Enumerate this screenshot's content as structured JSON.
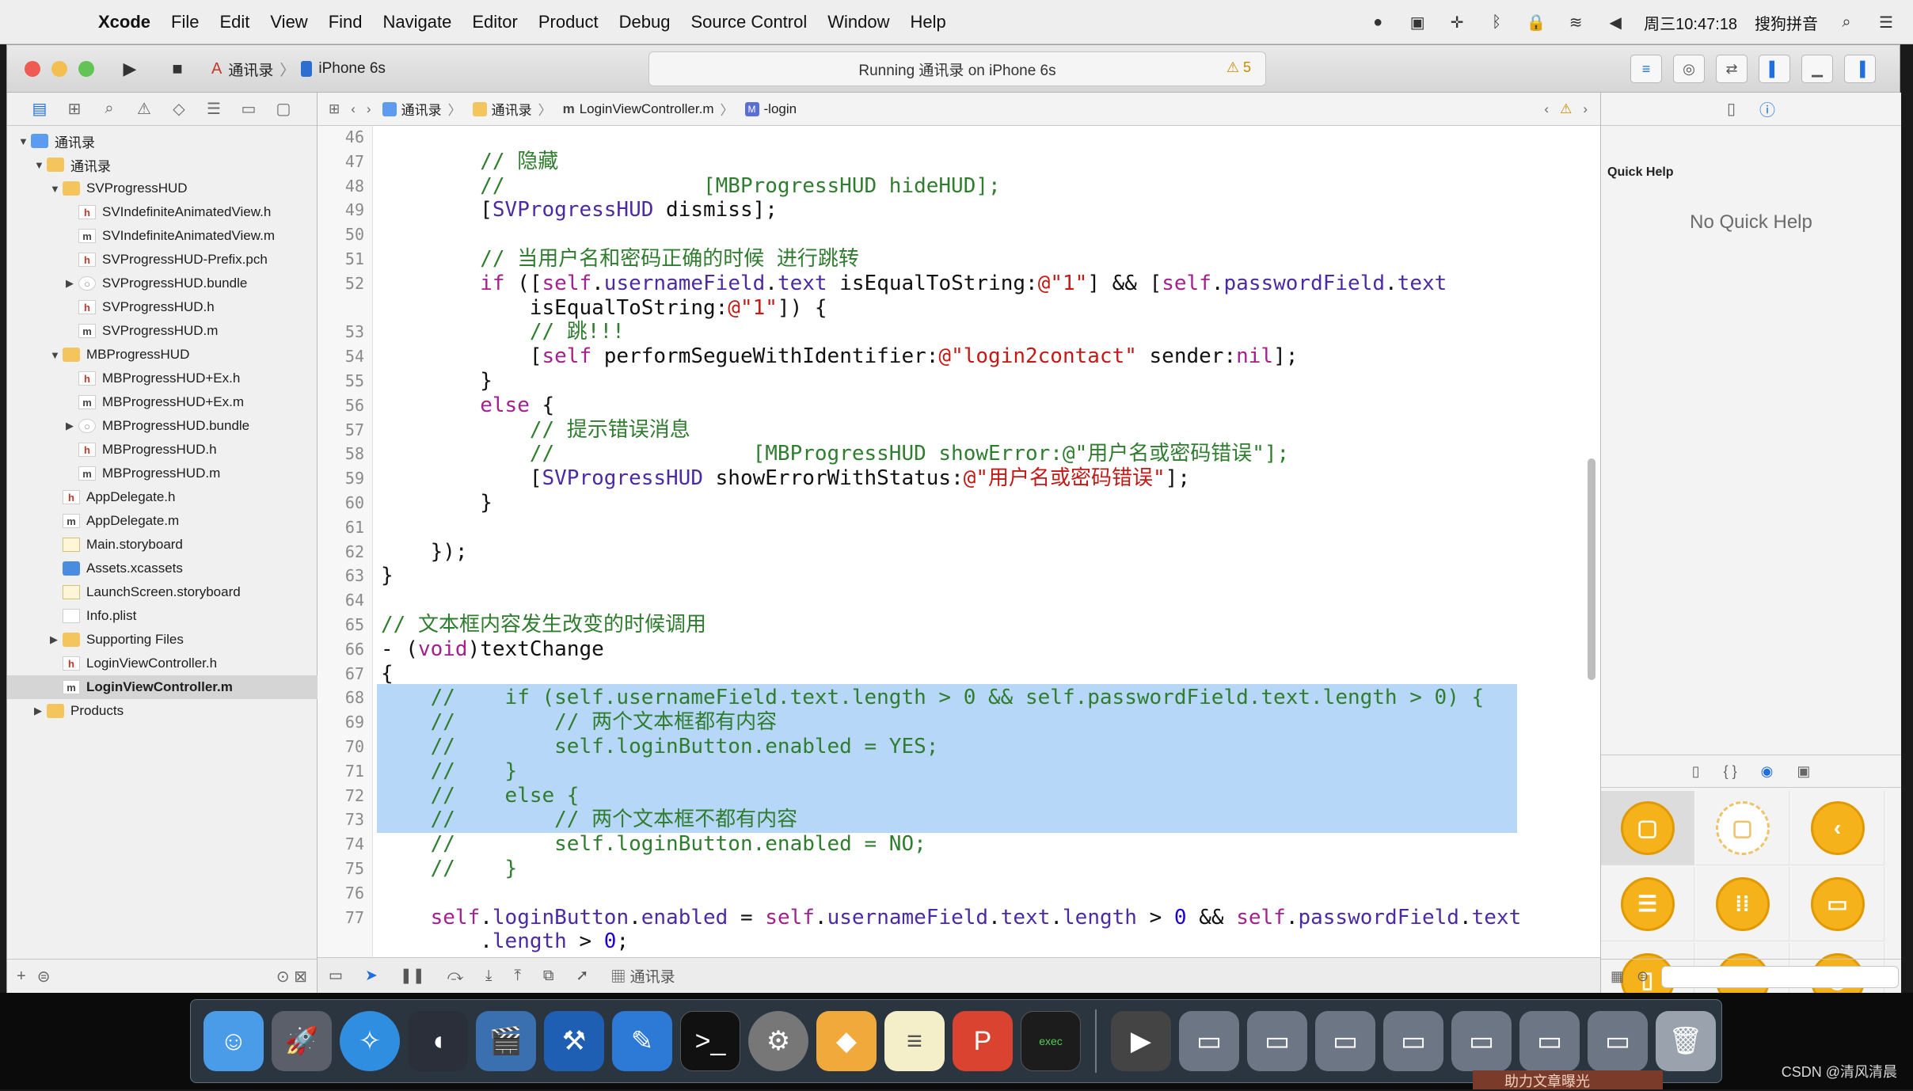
{
  "menubar": {
    "app": "Xcode",
    "items": [
      "File",
      "Edit",
      "View",
      "Find",
      "Navigate",
      "Editor",
      "Product",
      "Debug",
      "Source Control",
      "Window",
      "Help"
    ],
    "clock": "周三10:47:18",
    "input_method": "搜狗拼音"
  },
  "toolbar": {
    "scheme": "通讯录",
    "device": "iPhone 6s",
    "activity": "Running 通讯录 on iPhone 6s",
    "warnings": "5"
  },
  "navigator": {
    "items": [
      {
        "label": "通讯录",
        "icon": "proj",
        "indent": 0,
        "disc": "▼"
      },
      {
        "label": "通讯录",
        "icon": "folder",
        "indent": 1,
        "disc": "▼"
      },
      {
        "label": "SVProgressHUD",
        "icon": "folder",
        "indent": 2,
        "disc": "▼"
      },
      {
        "label": "SVIndefiniteAnimatedView.h",
        "icon": "h",
        "indent": 3,
        "disc": ""
      },
      {
        "label": "SVIndefiniteAnimatedView.m",
        "icon": "m",
        "indent": 3,
        "disc": ""
      },
      {
        "label": "SVProgressHUD-Prefix.pch",
        "icon": "h",
        "indent": 3,
        "disc": ""
      },
      {
        "label": "SVProgressHUD.bundle",
        "icon": "bundle",
        "indent": 3,
        "disc": "▶"
      },
      {
        "label": "SVProgressHUD.h",
        "icon": "h",
        "indent": 3,
        "disc": ""
      },
      {
        "label": "SVProgressHUD.m",
        "icon": "m",
        "indent": 3,
        "disc": ""
      },
      {
        "label": "MBProgressHUD",
        "icon": "folder",
        "indent": 2,
        "disc": "▼"
      },
      {
        "label": "MBProgressHUD+Ex.h",
        "icon": "h",
        "indent": 3,
        "disc": ""
      },
      {
        "label": "MBProgressHUD+Ex.m",
        "icon": "m",
        "indent": 3,
        "disc": ""
      },
      {
        "label": "MBProgressHUD.bundle",
        "icon": "bundle",
        "indent": 3,
        "disc": "▶"
      },
      {
        "label": "MBProgressHUD.h",
        "icon": "h",
        "indent": 3,
        "disc": ""
      },
      {
        "label": "MBProgressHUD.m",
        "icon": "m",
        "indent": 3,
        "disc": ""
      },
      {
        "label": "AppDelegate.h",
        "icon": "h",
        "indent": 2,
        "disc": ""
      },
      {
        "label": "AppDelegate.m",
        "icon": "m",
        "indent": 2,
        "disc": ""
      },
      {
        "label": "Main.storyboard",
        "icon": "sb",
        "indent": 2,
        "disc": ""
      },
      {
        "label": "Assets.xcassets",
        "icon": "xc",
        "indent": 2,
        "disc": ""
      },
      {
        "label": "LaunchScreen.storyboard",
        "icon": "sb",
        "indent": 2,
        "disc": ""
      },
      {
        "label": "Info.plist",
        "icon": "pl",
        "indent": 2,
        "disc": ""
      },
      {
        "label": "Supporting Files",
        "icon": "folder",
        "indent": 2,
        "disc": "▶"
      },
      {
        "label": "LoginViewController.h",
        "icon": "h",
        "indent": 2,
        "disc": ""
      },
      {
        "label": "LoginViewController.m",
        "icon": "m",
        "indent": 2,
        "disc": "",
        "selected": true
      },
      {
        "label": "Products",
        "icon": "folder",
        "indent": 1,
        "disc": "▶"
      }
    ]
  },
  "jumpbar": {
    "crumbs": [
      "通讯录",
      "通讯录",
      "LoginViewController.m",
      "-login"
    ]
  },
  "editor": {
    "lines": [
      {
        "n": "46",
        "t": ""
      },
      {
        "n": "47",
        "t": "        <span class=\"cm\">// 隐藏</span>"
      },
      {
        "n": "48",
        "t": "        <span class=\"cm\">//                [MBProgressHUD hideHUD];</span>"
      },
      {
        "n": "49",
        "t": "        [<span class=\"pr\">SVProgressHUD</span> dismiss];"
      },
      {
        "n": "50",
        "t": ""
      },
      {
        "n": "51",
        "t": "        <span class=\"cm\">// 当用户名和密码正确的时候 进行跳转</span>"
      },
      {
        "n": "52",
        "t": "        <span class=\"kw\">if</span> ([<span class=\"kw\">self</span>.<span class=\"pr\">usernameField</span>.<span class=\"pr\">text</span> isEqualToString:<span class=\"st\">@\"1\"</span>] &amp;&amp; [<span class=\"kw\">self</span>.<span class=\"pr\">passwordField</span>.<span class=\"pr\">text</span>"
      },
      {
        "n": "",
        "t": "            isEqualToString:<span class=\"st\">@\"1\"</span>]) {"
      },
      {
        "n": "53",
        "t": "            <span class=\"cm\">// 跳!!!</span>"
      },
      {
        "n": "54",
        "t": "            [<span class=\"kw\">self</span> performSegueWithIdentifier:<span class=\"st\">@\"login2contact\"</span> sender:<span class=\"kw\">nil</span>];"
      },
      {
        "n": "55",
        "t": "        }"
      },
      {
        "n": "56",
        "t": "        <span class=\"kw\">else</span> {"
      },
      {
        "n": "57",
        "t": "            <span class=\"cm\">// 提示错误消息</span>"
      },
      {
        "n": "58",
        "t": "            <span class=\"cm\">//                [MBProgressHUD showError:@\"用户名或密码错误\"];</span>"
      },
      {
        "n": "59",
        "t": "            [<span class=\"pr\">SVProgressHUD</span> showErrorWithStatus:<span class=\"st\">@\"用户名或密码错误\"</span>];"
      },
      {
        "n": "60",
        "t": "        }"
      },
      {
        "n": "61",
        "t": ""
      },
      {
        "n": "62",
        "t": "    });"
      },
      {
        "n": "63",
        "t": "}"
      },
      {
        "n": "64",
        "t": ""
      },
      {
        "n": "65",
        "t": "<span class=\"cm\">// 文本框内容发生改变的时候调用</span>"
      },
      {
        "n": "66",
        "t": "- (<span class=\"kw\">void</span>)textChange"
      },
      {
        "n": "67",
        "t": "{"
      },
      {
        "n": "68",
        "t": "    <span class=\"cm\">//    if (self.usernameField.text.length &gt; 0 &amp;&amp; self.passwordField.text.length &gt; 0) {</span>"
      },
      {
        "n": "69",
        "t": "    <span class=\"cm\">//        // 两个文本框都有内容</span>"
      },
      {
        "n": "70",
        "t": "    <span class=\"cm\">//        self.loginButton.enabled = YES;</span>"
      },
      {
        "n": "71",
        "t": "    <span class=\"cm\">//    }</span>"
      },
      {
        "n": "72",
        "t": "    <span class=\"cm\">//    else {</span>"
      },
      {
        "n": "73",
        "t": "    <span class=\"cm\">//        // 两个文本框不都有内容</span>"
      },
      {
        "n": "74",
        "t": "    <span class=\"cm\">//        self.loginButton.enabled = NO;</span>"
      },
      {
        "n": "75",
        "t": "    <span class=\"cm\">//    }</span>"
      },
      {
        "n": "76",
        "t": ""
      },
      {
        "n": "77",
        "t": "    <span class=\"kw\">self</span>.<span class=\"pr\">loginButton</span>.<span class=\"pr\">enabled</span> = <span class=\"kw\">self</span>.<span class=\"pr\">usernameField</span>.<span class=\"pr\">text</span>.<span class=\"pr\">length</span> &gt; <span class=\"nu\">0</span> &amp;&amp; <span class=\"kw\">self</span>.<span class=\"pr\">passwordField</span>.<span class=\"pr\">text</span>"
      },
      {
        "n": "",
        "t": "        .<span class=\"pr\">length</span> &gt; <span class=\"nu\">0</span>;"
      }
    ]
  },
  "debugbar": {
    "target": "通讯录"
  },
  "inspector": {
    "quick_help_title": "Quick Help",
    "no_help": "No Quick Help"
  },
  "watermark": "CSDN @清风清晨",
  "overlay_text": "助力文章曝光"
}
